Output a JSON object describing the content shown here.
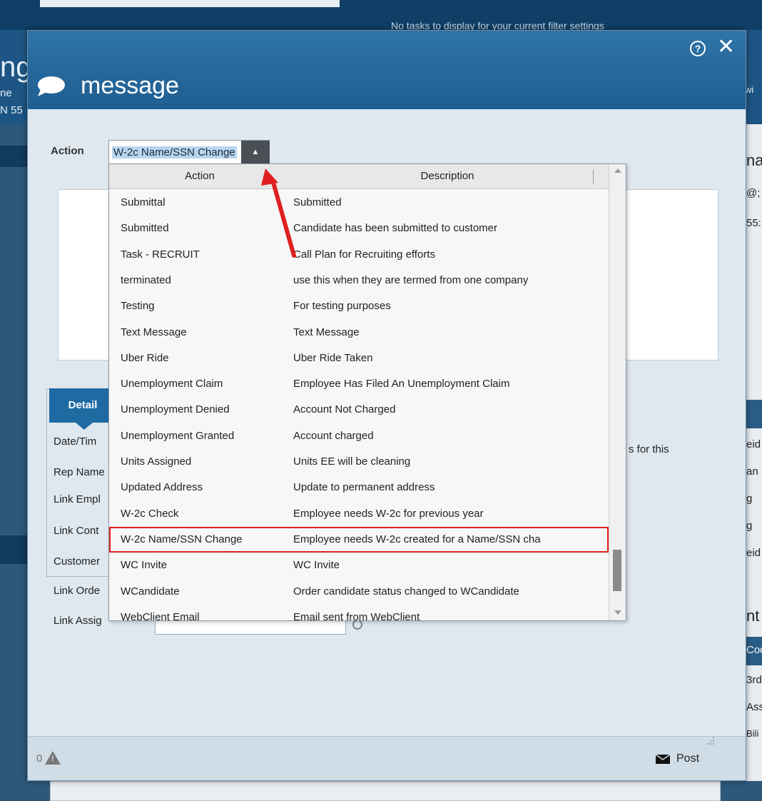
{
  "background": {
    "top_notice": "No tasks to display for your current filter settings",
    "header_title_fragment": "ng",
    "header_line1_fragment": "ne",
    "header_line2_fragment": "N 55",
    "right_tab_fragment": "wi",
    "right_fragments": [
      "na",
      "@;",
      "55:",
      "eid",
      "an",
      "g",
      "g",
      "eid",
      "nt",
      "Cod",
      "3rd",
      "Ass",
      "Bili"
    ]
  },
  "modal": {
    "title": "message",
    "help_glyph": "?",
    "close_glyph": "✕"
  },
  "form": {
    "action_label": "Action",
    "action_value": "W-2c Name/SSN Change",
    "select_arrow": "▲"
  },
  "detail": {
    "tab_label": "Detail",
    "field_labels": [
      "Date/Tim",
      "Rep Name",
      "Link Empl",
      "Link Cont",
      "Customer",
      "Link Orde",
      "Link Assig"
    ],
    "tasks_text": "s for this"
  },
  "dropdown": {
    "header_action": "Action",
    "header_description": "Description",
    "rows": [
      {
        "action": "Submittal",
        "description": "Submitted"
      },
      {
        "action": "Submitted",
        "description": "Candidate has been submitted to customer"
      },
      {
        "action": "Task - RECRUIT",
        "description": "Call Plan for Recruiting efforts"
      },
      {
        "action": "terminated",
        "description": "use this when they are termed from one company"
      },
      {
        "action": "Testing",
        "description": "For testing purposes"
      },
      {
        "action": "Text Message",
        "description": "Text Message"
      },
      {
        "action": "Uber Ride",
        "description": "Uber Ride Taken"
      },
      {
        "action": "Unemployment Claim",
        "description": "Employee Has Filed An Unemployment Claim"
      },
      {
        "action": "Unemployment Denied",
        "description": "Account Not Charged"
      },
      {
        "action": "Unemployment Granted",
        "description": "Account charged"
      },
      {
        "action": "Units Assigned",
        "description": "Units EE will be cleaning"
      },
      {
        "action": "Updated Address",
        "description": "Update to permanent address"
      },
      {
        "action": "W-2c Check",
        "description": "Employee needs W-2c for previous year"
      },
      {
        "action": "W-2c Name/SSN Change",
        "description": "Employee needs W-2c created for a Name/SSN cha"
      },
      {
        "action": "WC Invite",
        "description": "WC Invite"
      },
      {
        "action": "WCandidate",
        "description": "Order candidate status changed to WCandidate"
      },
      {
        "action": "WebClient Email",
        "description": "Email sent from WebClient"
      }
    ],
    "selected_index": 13
  },
  "footer": {
    "warning_count": "0",
    "post_label": "Post"
  },
  "colors": {
    "header_blue": "#1f5e91",
    "selection_outline": "#e02020",
    "annotation_arrow": "#e02020"
  },
  "icons": [
    "chat-bubble-icon",
    "help-icon",
    "close-icon",
    "warning-icon",
    "mail-icon",
    "resize-grip-icon"
  ]
}
